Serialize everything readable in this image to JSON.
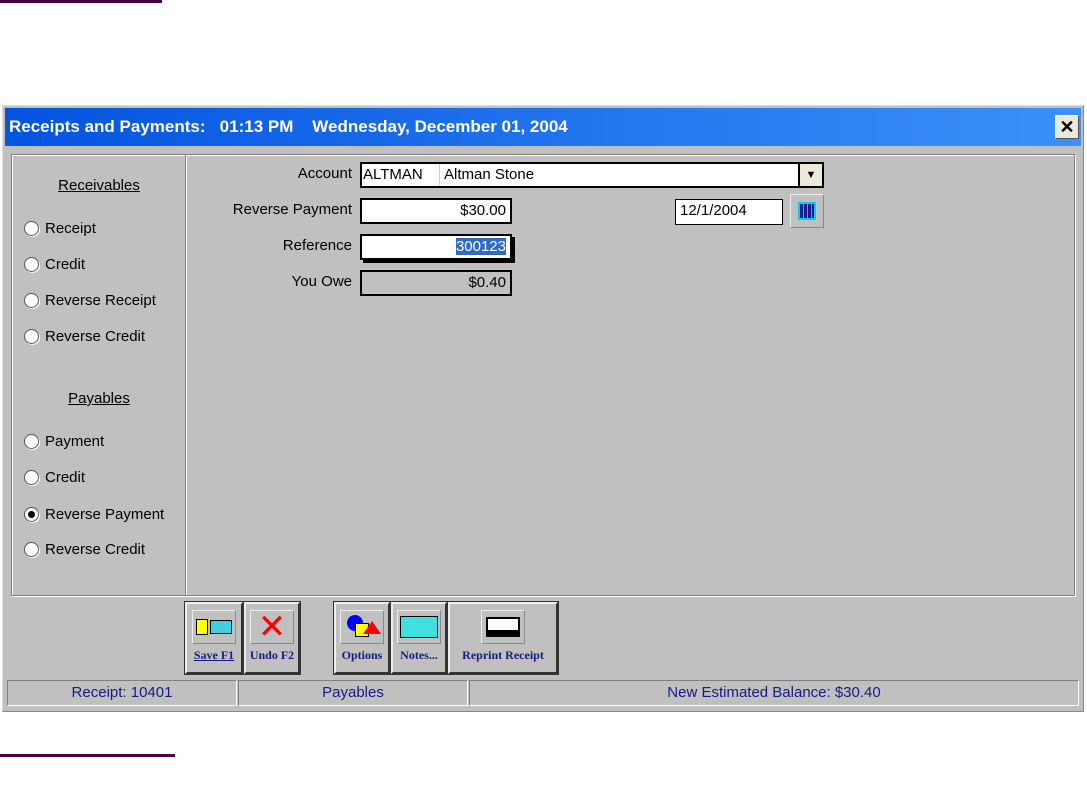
{
  "window": {
    "title": "Receipts and Payments:   01:13 PM    Wednesday, December 01, 2004",
    "close": "✕"
  },
  "left": {
    "receivables_header": "Receivables",
    "receivables": [
      {
        "label": "Receipt",
        "selected": false
      },
      {
        "label": "Credit",
        "selected": false
      },
      {
        "label": "Reverse Receipt",
        "selected": false
      },
      {
        "label": "Reverse Credit",
        "selected": false
      }
    ],
    "payables_header": "Payables",
    "payables": [
      {
        "label": "Payment",
        "selected": false
      },
      {
        "label": "Credit",
        "selected": false
      },
      {
        "label": "Reverse Payment",
        "selected": true
      },
      {
        "label": "Reverse Credit",
        "selected": false
      }
    ]
  },
  "form": {
    "account_label": "Account",
    "account_code": "ALTMAN",
    "account_name": "Altman Stone",
    "amount_label": "Reverse Payment",
    "amount": "$30.00",
    "date": "12/1/2004",
    "reference_label": "Reference",
    "reference": "300123",
    "owe_label": "You Owe",
    "owe": "$0.40"
  },
  "buttons": {
    "save": "Save F1",
    "undo": "Undo F2",
    "options": "Options",
    "notes": "Notes...",
    "reprint": "Reprint Receipt"
  },
  "status": {
    "receipt": "Receipt:  10401",
    "type": "Payables",
    "balance": "New Estimated Balance:  $30.40"
  }
}
